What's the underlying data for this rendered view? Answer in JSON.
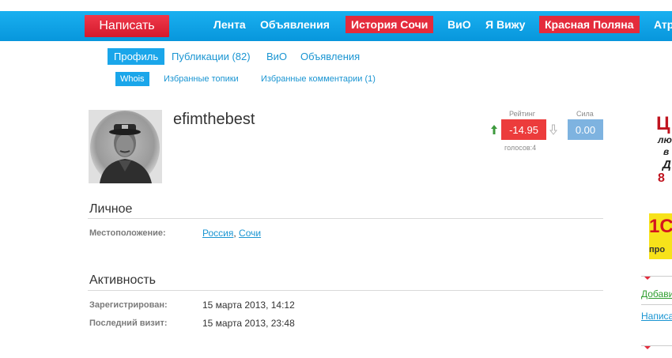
{
  "header": {
    "write_button": "Написать",
    "nav": [
      {
        "label": "Лента",
        "highlight": false
      },
      {
        "label": "Объявления",
        "highlight": false
      },
      {
        "label": "История Сочи",
        "highlight": true
      },
      {
        "label": "ВиО",
        "highlight": false
      },
      {
        "label": "Я Вижу",
        "highlight": false
      },
      {
        "label": "Красная Поляна",
        "highlight": true
      },
      {
        "label": "Атр",
        "highlight": false
      }
    ]
  },
  "tabs": [
    {
      "label": "Профиль",
      "active": true
    },
    {
      "label": "Публикации (82)",
      "active": false
    },
    {
      "label": "ВиО",
      "active": false
    },
    {
      "label": "Объявления",
      "active": false
    }
  ],
  "subtabs": [
    {
      "label": "Whois",
      "active": true
    },
    {
      "label": "Избранные топики",
      "active": false
    },
    {
      "label": "Избранные комментарии (1)",
      "active": false
    }
  ],
  "profile": {
    "username": "efimthebest",
    "rating_label": "Рейтинг",
    "rating_value": "-14.95",
    "power_label": "Сила",
    "power_value": "0.00",
    "votes": "голосов:4"
  },
  "personal": {
    "title": "Личное",
    "location_label": "Местоположение:",
    "country": "Россия",
    "separator": ",",
    "city": "Сочи"
  },
  "activity": {
    "title": "Активность",
    "registered_label": "Зарегистрирован:",
    "registered_value": "15 марта 2013, 14:12",
    "last_visit_label": "Последний визит:",
    "last_visit_value": "15 марта 2013, 23:48"
  },
  "sidebar": {
    "ad1_lines": [
      "Ц",
      "лю",
      "в",
      "Д",
      "8"
    ],
    "ad2_lines": [
      "1С",
      "про"
    ],
    "link_add": "Добави",
    "link_write": "Написат"
  },
  "colors": {
    "topbar": "#0a9be0",
    "accent_red": "#e42b3c",
    "link_blue": "#1a95d2",
    "rating_red": "#ec3c3c",
    "power_blue": "#7eb3e0",
    "sidebar_green": "#2f9e2f"
  }
}
